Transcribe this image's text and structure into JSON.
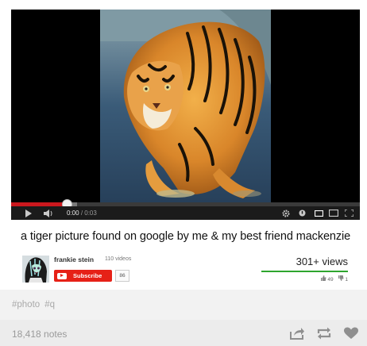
{
  "player": {
    "current_time": "0:00",
    "duration": "/ 0:03",
    "progress_fraction": 0.16,
    "buffered_fraction": 0.03
  },
  "video": {
    "title": "a tiger picture found on google by me & my best friend mackenzie",
    "channel": "frankie stein",
    "video_count": "110 videos",
    "subscribe_label": "Subscribe",
    "subscriber_count": "86",
    "views": "301+ views",
    "likes": "49",
    "dislikes": "1"
  },
  "post": {
    "tags": [
      "#photo",
      "#q"
    ],
    "notes": "18,418 notes"
  },
  "colors": {
    "progress_played": "#cc181e",
    "subscribe_red": "#e62117",
    "views_bar_green": "#2ea52e"
  },
  "icons": {
    "controls": [
      "play-icon",
      "volume-icon",
      "settings-gear-icon",
      "annotations-icon",
      "small-player-icon",
      "large-player-icon",
      "fullscreen-icon"
    ],
    "post_actions": [
      "share-icon",
      "reblog-icon",
      "like-heart-icon"
    ]
  }
}
